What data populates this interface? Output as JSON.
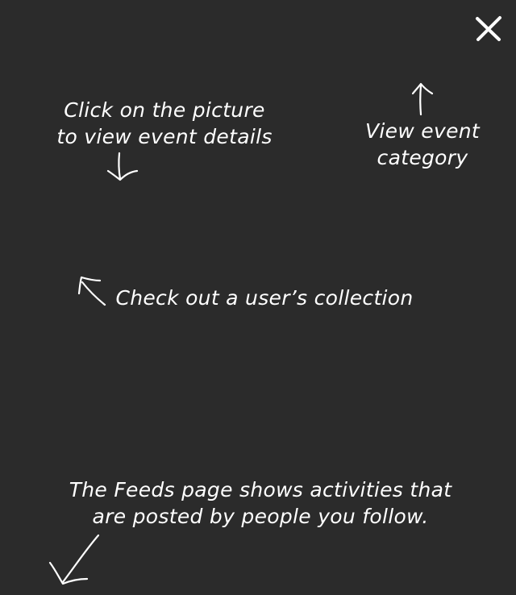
{
  "overlay": {
    "background_color": "#2b2b2b",
    "text_color": "#ffffff",
    "close_icon": "close-icon"
  },
  "tips": {
    "event_details": {
      "line1": "Click on the picture",
      "line2": "to view event details",
      "arrow_icon": "arrow-down-icon"
    },
    "event_category": {
      "line1": "View event",
      "line2": "category",
      "arrow_icon": "arrow-up-icon"
    },
    "user_collection": {
      "line1": "Check out a user’s collection",
      "arrow_icon": "arrow-up-left-icon"
    },
    "feeds_page": {
      "line1": "The Feeds page shows activities that",
      "line2": "are posted by people you follow.",
      "arrow_icon": "arrow-down-left-icon"
    }
  }
}
